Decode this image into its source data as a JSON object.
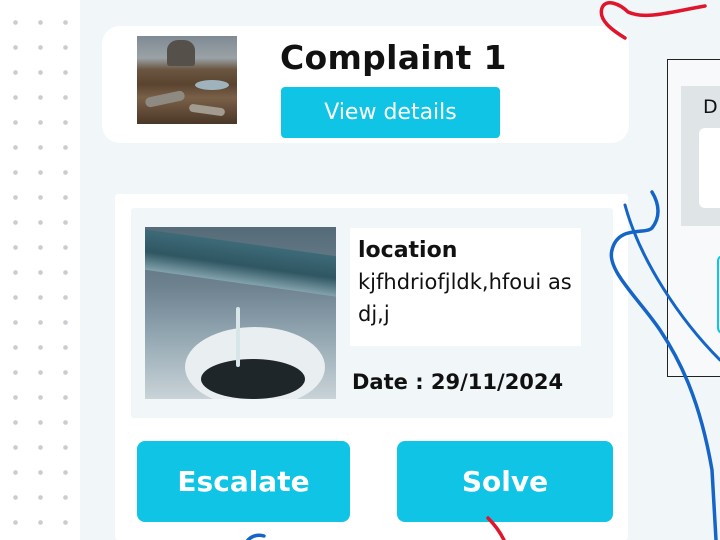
{
  "complaint": {
    "title": "Complaint 1",
    "view_details_label": "View details",
    "location_label": "location",
    "location_value": "kjfhdriofjldk,hfoui asdj,j",
    "date_text": "Date : 29/11/2024"
  },
  "actions": {
    "escalate_label": "Escalate",
    "solve_label": "Solve"
  },
  "side_panel": {
    "label_fragment": "D"
  },
  "colors": {
    "accent": "#10c4e6",
    "panel_bg": "#f1f6f8",
    "ink_red": "#e0152b",
    "ink_blue": "#1565c8"
  }
}
